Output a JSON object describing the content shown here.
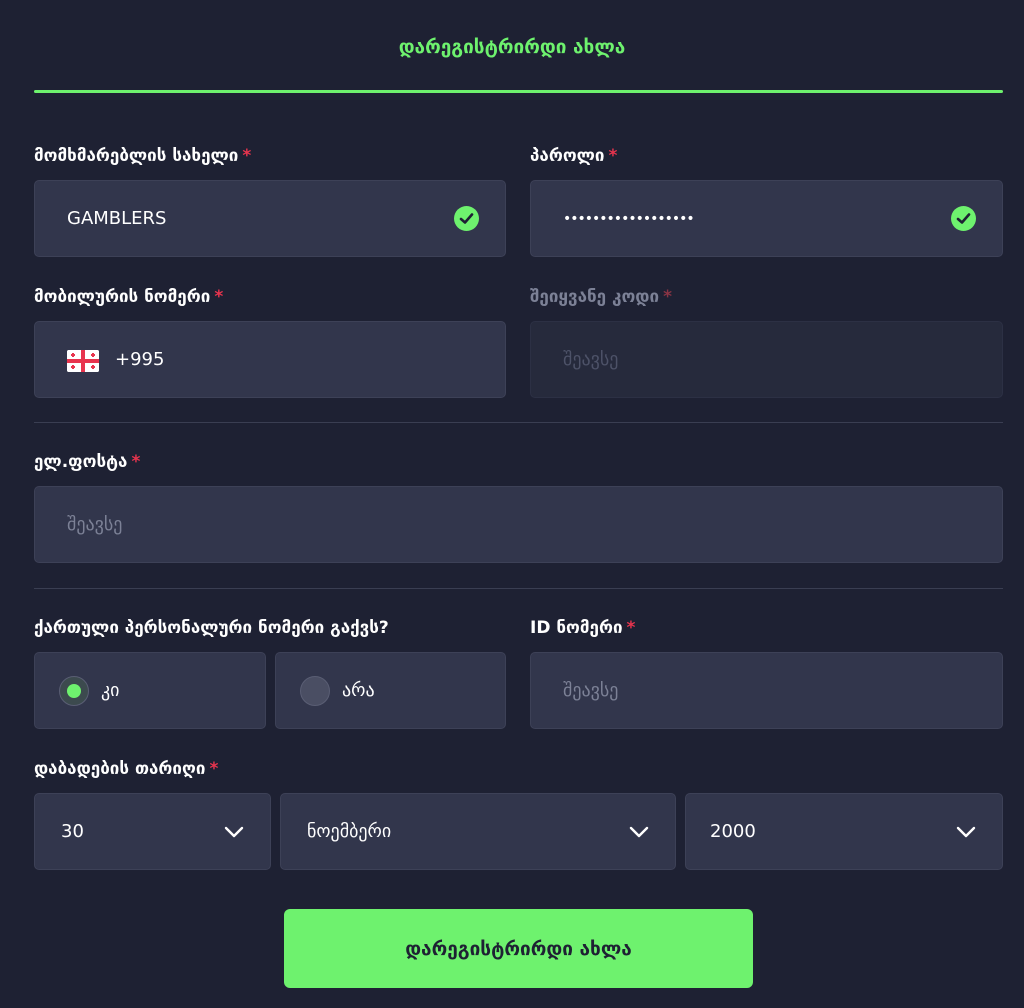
{
  "header": {
    "title": "დარეგისტრირდი ახლა"
  },
  "form": {
    "required_mark": "*",
    "username": {
      "label": "მომხმარებლის სახელი",
      "value": "GAMBLERS",
      "valid": true
    },
    "password": {
      "label": "პაროლი",
      "value": "••••••••••••••••••",
      "valid": true
    },
    "mobile": {
      "label": "მობილურის ნომერი",
      "country_flag": "georgia-flag-icon",
      "prefix": "+995"
    },
    "code": {
      "label": "შეიყვანე კოდი",
      "placeholder": "შეავსე",
      "disabled": true
    },
    "email": {
      "label": "ელ.ფოსტა",
      "placeholder": "შეავსე"
    },
    "personal_number": {
      "question": "ქართული პერსონალური ნომერი გაქვს?",
      "options": [
        {
          "label": "კი",
          "selected": true
        },
        {
          "label": "არა",
          "selected": false
        }
      ]
    },
    "id_number": {
      "label": "ID ნომერი",
      "placeholder": "შეავსე"
    },
    "birth_date": {
      "label": "დაბადების თარიღი",
      "day": "30",
      "month": "ნოემბერი",
      "year": "2000"
    },
    "submit_label": "დარეგისტრირდი ახლა"
  },
  "colors": {
    "accent": "#6ef26e",
    "background": "#1e2133",
    "field": "#32364c",
    "required": "#e8344e"
  }
}
